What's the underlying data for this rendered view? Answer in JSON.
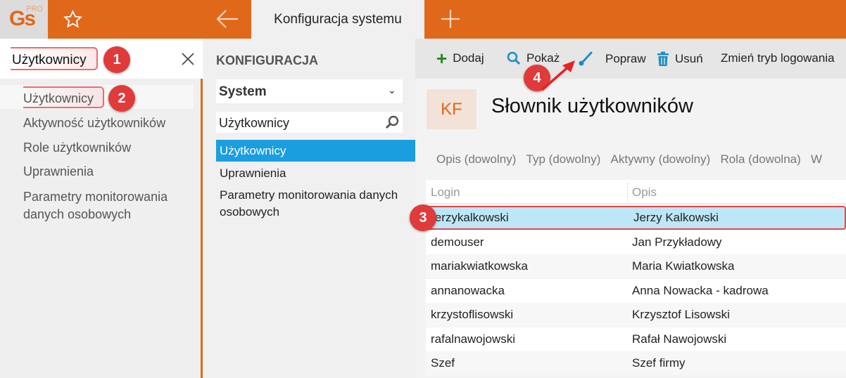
{
  "topbar": {
    "logo": "Gs",
    "logo_sup": "PRO",
    "tab_title": "Konfiguracja systemu"
  },
  "left": {
    "search_value": "Użytkownicy",
    "items": [
      "Użytkownicy",
      "Aktywność użytkowników",
      "Role użytkowników",
      "Uprawnienia",
      "Parametry monitorowania danych osobowych"
    ]
  },
  "mid": {
    "title": "KONFIGURACJA",
    "select": "System",
    "search_value": "Użytkownicy",
    "items": [
      "Użytkownicy",
      "Uprawnienia",
      "Parametry monitorowania danych osobowych"
    ]
  },
  "toolbar": {
    "add": "Dodaj",
    "show": "Pokaż",
    "edit": "Popraw",
    "delete": "Usuń",
    "login_mode": "Zmień tryb logowania"
  },
  "content": {
    "badge": "KF",
    "title": "Słownik użytkowników",
    "filters": [
      "Opis (dowolny)",
      "Typ (dowolny)",
      "Aktywny (dowolny)",
      "Rola (dowolna)",
      "W"
    ],
    "columns": [
      "Login",
      "Opis"
    ],
    "rows": [
      [
        "jerzykalkowski",
        "Jerzy Kalkowski"
      ],
      [
        "demouser",
        "Jan Przykładowy"
      ],
      [
        "mariakwiatkowska",
        "Maria Kwiatkowska"
      ],
      [
        "annanowacka",
        "Anna Nowacka - kadrowa"
      ],
      [
        "krzystoflisowski",
        "Krzysztof Lisowski"
      ],
      [
        "rafalnawojowski",
        "Rafał Nawojowski"
      ],
      [
        "Szef",
        "Szef firmy"
      ]
    ]
  },
  "annotations": [
    "1",
    "2",
    "3",
    "4"
  ]
}
